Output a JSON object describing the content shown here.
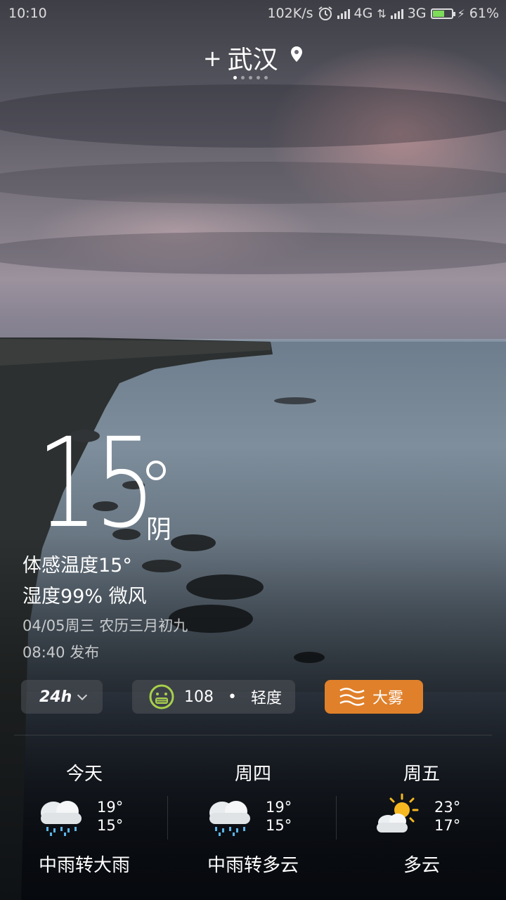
{
  "status_bar": {
    "time": "10:10",
    "net_speed": "102K/s",
    "sim1": "4G",
    "sim2": "3G",
    "battery": "61%",
    "battery_level": 0.61,
    "battery_color": "#7ddc5a"
  },
  "header": {
    "add_symbol": "+",
    "city": "武汉",
    "page_count": 5,
    "active_page": 1
  },
  "current": {
    "temperature": "15",
    "condition": "阴",
    "feels_like": "体感温度15°",
    "humidity_wind": "湿度99%  微风",
    "date": "04/05周三    农历三月初九",
    "published": "08:40 发布"
  },
  "chips": {
    "hourly_label": "24h",
    "aqi_value": "108",
    "aqi_level": "轻度",
    "aqi_separator": "•",
    "alert_label": "大雾",
    "alert_color": "#e0802a"
  },
  "forecast": [
    {
      "day": "今天",
      "high": "19°",
      "low": "15°",
      "desc": "中雨转大雨",
      "icon": "rain-cloud-icon"
    },
    {
      "day": "周四",
      "high": "19°",
      "low": "15°",
      "desc": "中雨转多云",
      "icon": "rain-cloud-icon"
    },
    {
      "day": "周五",
      "high": "23°",
      "low": "17°",
      "desc": "多云",
      "icon": "sun-cloud-icon"
    }
  ]
}
